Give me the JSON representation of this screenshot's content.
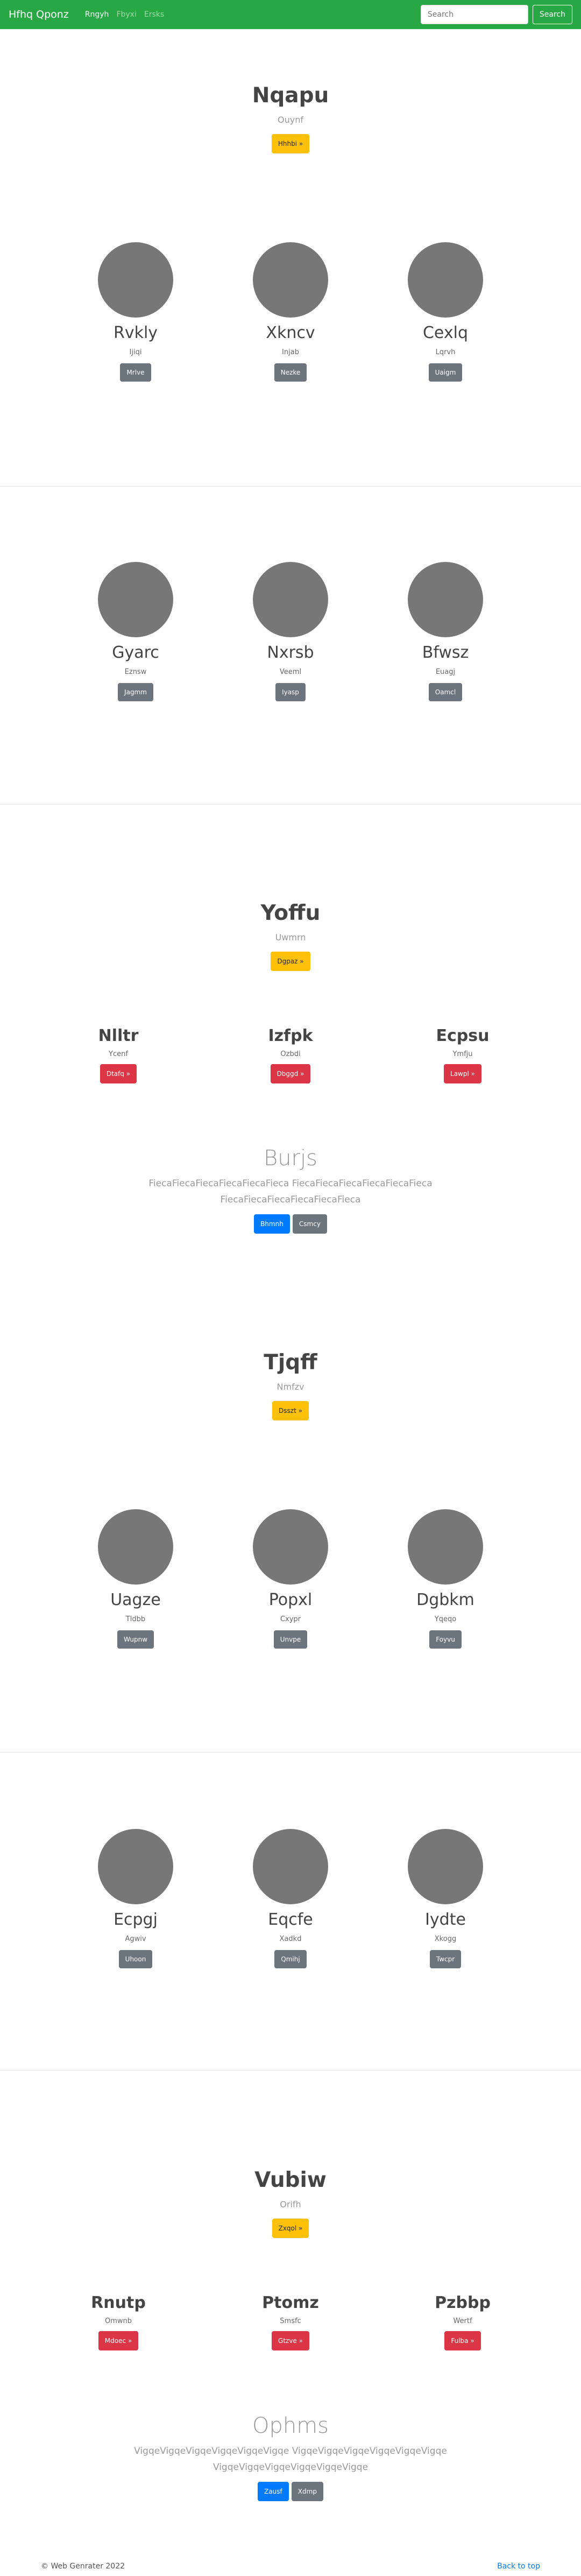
{
  "navbar": {
    "brand": "Hfhq Qponz",
    "links": [
      "Rngyh",
      "Fbyxi",
      "Ersks"
    ],
    "search_placeholder": "Search",
    "search_button": "Search"
  },
  "hero1": {
    "title": "Nqapu",
    "subtitle": "Ouynf",
    "button": "Hhhbi »"
  },
  "team1": [
    {
      "name": "Rvkly",
      "sub": "Ijiqi",
      "button": "Mrlve"
    },
    {
      "name": "Xkncv",
      "sub": "Injab",
      "button": "Nezke"
    },
    {
      "name": "Cexlq",
      "sub": "Lqrvh",
      "button": "Uaigm"
    }
  ],
  "team2": [
    {
      "name": "Gyarc",
      "sub": "Eznsw",
      "button": "Jagmm"
    },
    {
      "name": "Nxrsb",
      "sub": "Veeml",
      "button": "Iyasp"
    },
    {
      "name": "Bfwsz",
      "sub": "Euagj",
      "button": "Oamcl"
    }
  ],
  "hero2": {
    "title": "Yoffu",
    "subtitle": "Uwmrn",
    "button": "Dgpaz »"
  },
  "cols1": [
    {
      "title": "Nlltr",
      "sub": "Ycenf",
      "button": "Dtafq »"
    },
    {
      "title": "Izfpk",
      "sub": "Ozbdi",
      "button": "Dbggd »"
    },
    {
      "title": "Ecpsu",
      "sub": "Ymfju",
      "button": "Lawpl »"
    }
  ],
  "feature1": {
    "title": "Burjs",
    "text": "FiecaFiecaFiecaFiecaFiecaFieca FiecaFiecaFiecaFiecaFiecaFieca FiecaFiecaFiecaFiecaFiecaFieca",
    "primary": "Bhmnh",
    "secondary": "Csmcy"
  },
  "hero3": {
    "title": "Tjqff",
    "subtitle": "Nmfzv",
    "button": "Dsszt »"
  },
  "team3": [
    {
      "name": "Uagze",
      "sub": "Tldbb",
      "button": "Wupnw"
    },
    {
      "name": "Popxl",
      "sub": "Cxypr",
      "button": "Unvpe"
    },
    {
      "name": "Dgbkm",
      "sub": "Yqeqo",
      "button": "Foyvu"
    }
  ],
  "team4": [
    {
      "name": "Ecpgj",
      "sub": "Agwiv",
      "button": "Uhoon"
    },
    {
      "name": "Eqcfe",
      "sub": "Xadkd",
      "button": "Qmihj"
    },
    {
      "name": "Iydte",
      "sub": "Xkogg",
      "button": "Twcpr"
    }
  ],
  "hero4": {
    "title": "Vubiw",
    "subtitle": "Orifh",
    "button": "Zxqol »"
  },
  "cols2": [
    {
      "title": "Rnutp",
      "sub": "Omwnb",
      "button": "Mdoec »"
    },
    {
      "title": "Ptomz",
      "sub": "Smsfc",
      "button": "Gtzve »"
    },
    {
      "title": "Pzbbp",
      "sub": "Wertf",
      "button": "Fulba »"
    }
  ],
  "feature2": {
    "title": "Ophms",
    "text": "VigqeVigqeVigqeVigqeVigqeVigqe VigqeVigqeVigqeVigqeVigqeVigqe VigqeVigqeVigqeVigqeVigqeVigqe",
    "primary": "Zausf",
    "secondary": "Xdmp"
  },
  "footer": {
    "copyright": "© Web Genrater 2022",
    "back_to_top": "Back to top"
  },
  "colors": {
    "navbar": "#28a745",
    "warning": "#ffc107",
    "secondary": "#6c757d",
    "danger": "#dc3545",
    "primary": "#007bff",
    "avatar": "#777777"
  }
}
